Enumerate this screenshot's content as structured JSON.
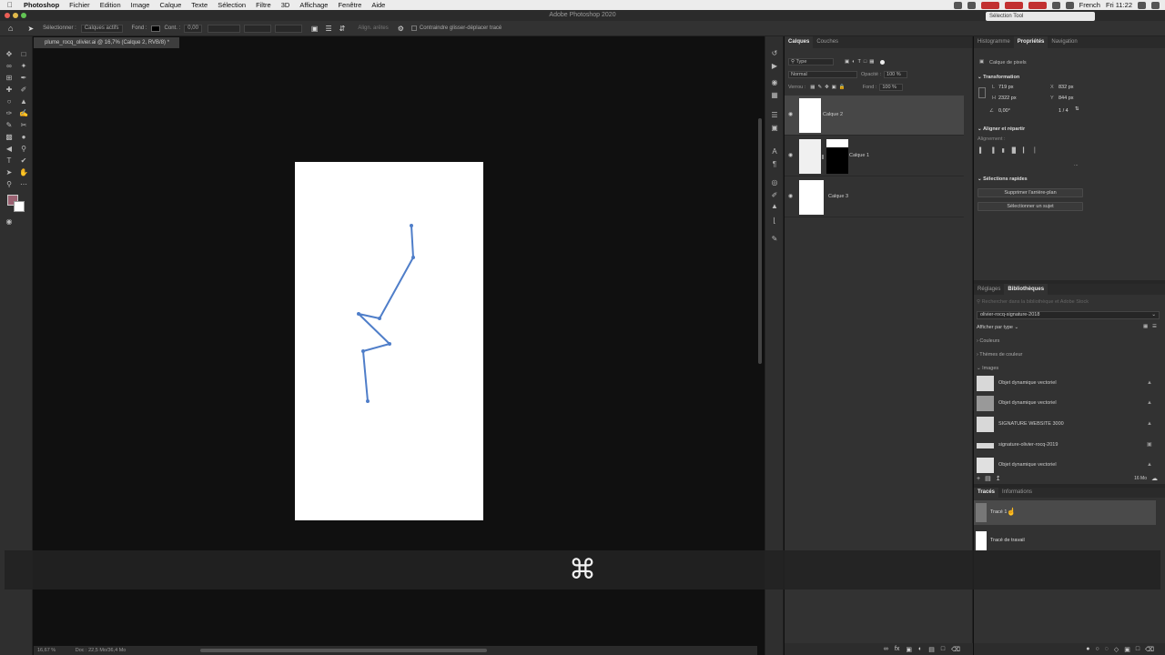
{
  "menubar": {
    "app_name": "Photoshop",
    "items": [
      "Fichier",
      "Edition",
      "Image",
      "Calque",
      "Texte",
      "Sélection",
      "Filtre",
      "3D",
      "Affichage",
      "Fenêtre",
      "Aide"
    ],
    "language": "French",
    "clock": "Fri 11:22"
  },
  "window": {
    "title": "Adobe Photoshop 2020"
  },
  "search_popup": {
    "text": "Sélection Tool"
  },
  "options_bar": {
    "select_label": "Sélectionner :",
    "select_value": "Calques actifs",
    "fill_label": "Fond :",
    "stroke_label": "Cont. :",
    "stroke_value": "0,00",
    "path_align_label": "Align. arêtes",
    "constrain_label": "Contraindre glisser-déplacer tracé"
  },
  "document_tab": {
    "label": "plume_rocq_olivier.ai @ 16,7% (Calque 2, RVB/8) *"
  },
  "status_bar": {
    "zoom": "16,67 %",
    "doc_info": "Doc : 22,5 Mo/36,4 Mo"
  },
  "overlay": {
    "shortcut_symbol": "⌘"
  },
  "layers_panel": {
    "tabs": [
      "Calques",
      "Couches"
    ],
    "filter_value": "Type",
    "blend_mode": "Normal",
    "opacity_label": "Opacité :",
    "opacity_value": "100 %",
    "lock_label": "Verrou :",
    "fill_label": "Fond :",
    "fill_value": "100 %",
    "layers": [
      {
        "name": "Calque 2",
        "selected": true
      },
      {
        "name": "Calque 1",
        "selected": false
      },
      {
        "name": "Calque 3",
        "selected": false
      }
    ]
  },
  "properties_panel": {
    "tabs": [
      "Histogramme",
      "Propriétés",
      "Navigation"
    ],
    "layer_type": "Calque de pixels",
    "transform_title": "Transformation",
    "w_label": "L",
    "w_value": "719 px",
    "h_label": "H",
    "h_value": "2322 px",
    "x_label": "X",
    "x_value": "832 px",
    "y_label": "Y",
    "y_value": "844 px",
    "angle_value": "0,00°",
    "page_value": "1 / 4",
    "align_title": "Aligner et répartir",
    "align_sub": "Alignement :",
    "more": "...",
    "quick_title": "Sélections rapides",
    "remove_bg": "Supprimer l'arrière-plan",
    "select_subject": "Sélectionner un sujet"
  },
  "libraries_panel": {
    "tabs": [
      "Réglages",
      "Bibliothèques"
    ],
    "search_placeholder": "Rechercher dans la bibliothèque et Adobe Stock",
    "library_name": "olivier-rocq-signature-2018",
    "view_by": "Afficher par type",
    "sections": [
      "Couleurs",
      "Thèmes de couleur",
      "Images"
    ],
    "items": [
      "Objet dynamique vectoriel",
      "Objet dynamique vectoriel",
      "SIGNATURE WEBSITE 3000",
      "signature-olivier-rocq-2019",
      "Objet dynamique vectoriel"
    ],
    "storage": "16 Mo"
  },
  "paths_panel": {
    "tabs": [
      "Tracés",
      "Informations"
    ],
    "paths": [
      {
        "name": "Tracé 1",
        "selected": true
      },
      {
        "name": "Tracé de travail",
        "selected": false
      }
    ]
  },
  "colors": {
    "path_stroke": "#4f7ec9",
    "foreground_swatch": "#9b6272",
    "panel_bg": "#323232"
  }
}
